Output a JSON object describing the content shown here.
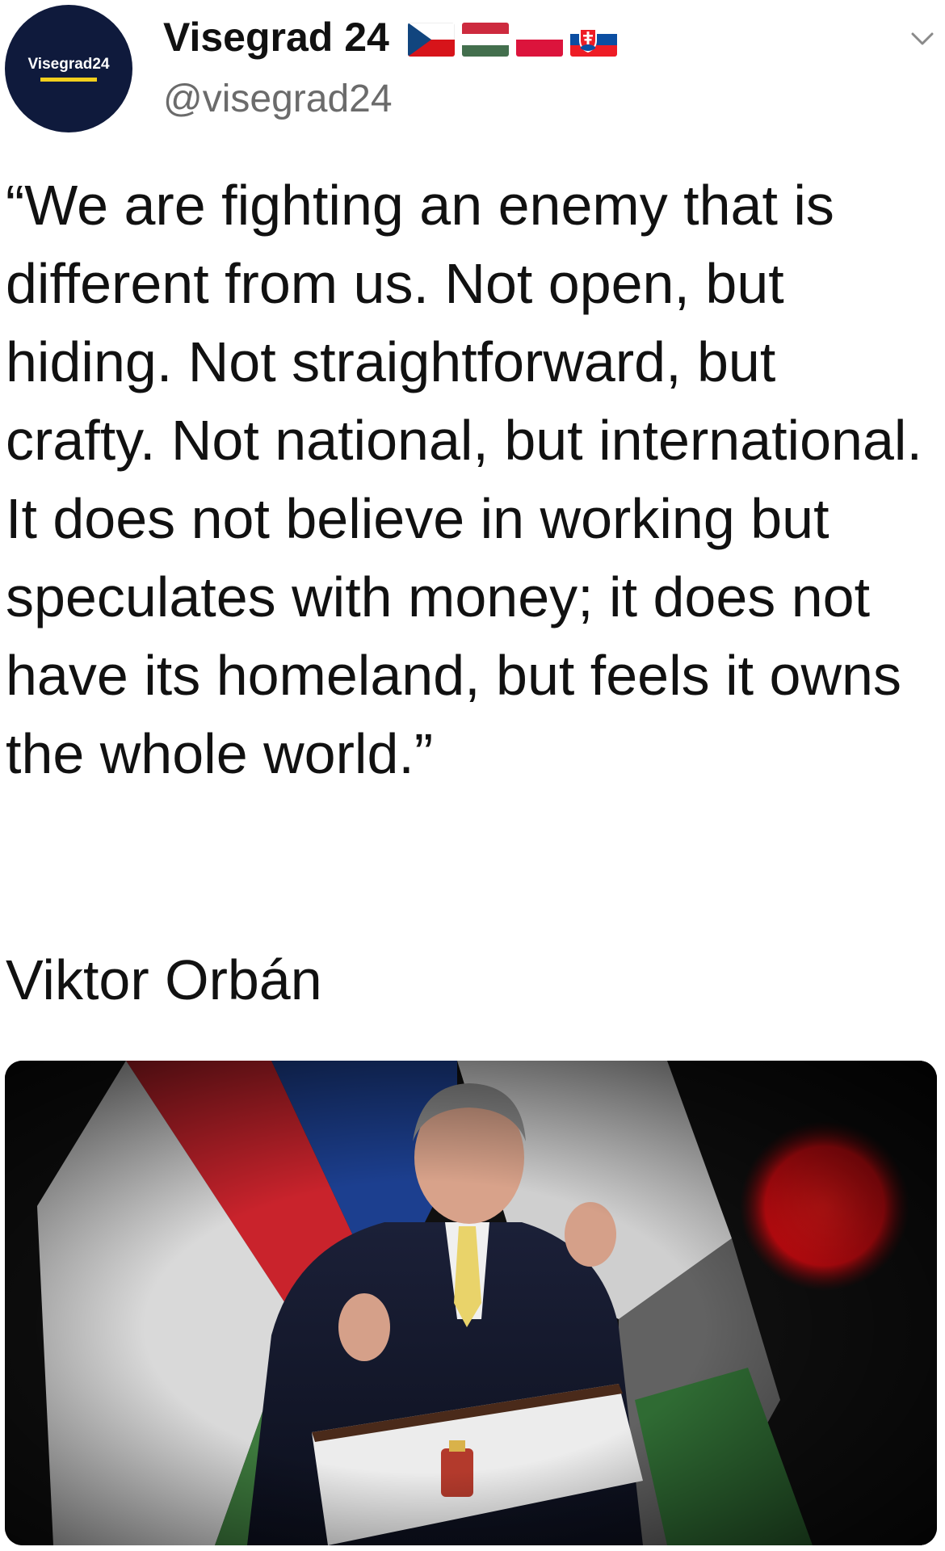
{
  "account": {
    "display_name": "Visegrad 24",
    "handle": "@visegrad24",
    "avatar_text": "Visegrad24",
    "flags": [
      "czech-flag",
      "hungary-flag",
      "poland-flag",
      "slovakia-flag"
    ],
    "menu_icon": "chevron-down-icon"
  },
  "tweet": {
    "quote": "“We are fighting an enemy that is different from us. Not open, but hiding. Not straightforward, but crafty. Not national, but international. It does not believe in working but speculates with money; it does not have its homeland, but feels it owns the whole world.”",
    "attribution": "Viktor Orbán"
  },
  "colors": {
    "avatar_bg": "#0f1a3c",
    "avatar_accent": "#f2cf1d",
    "text": "#111111",
    "handle": "#6b6b6b",
    "chevron": "#8a8a8a"
  }
}
